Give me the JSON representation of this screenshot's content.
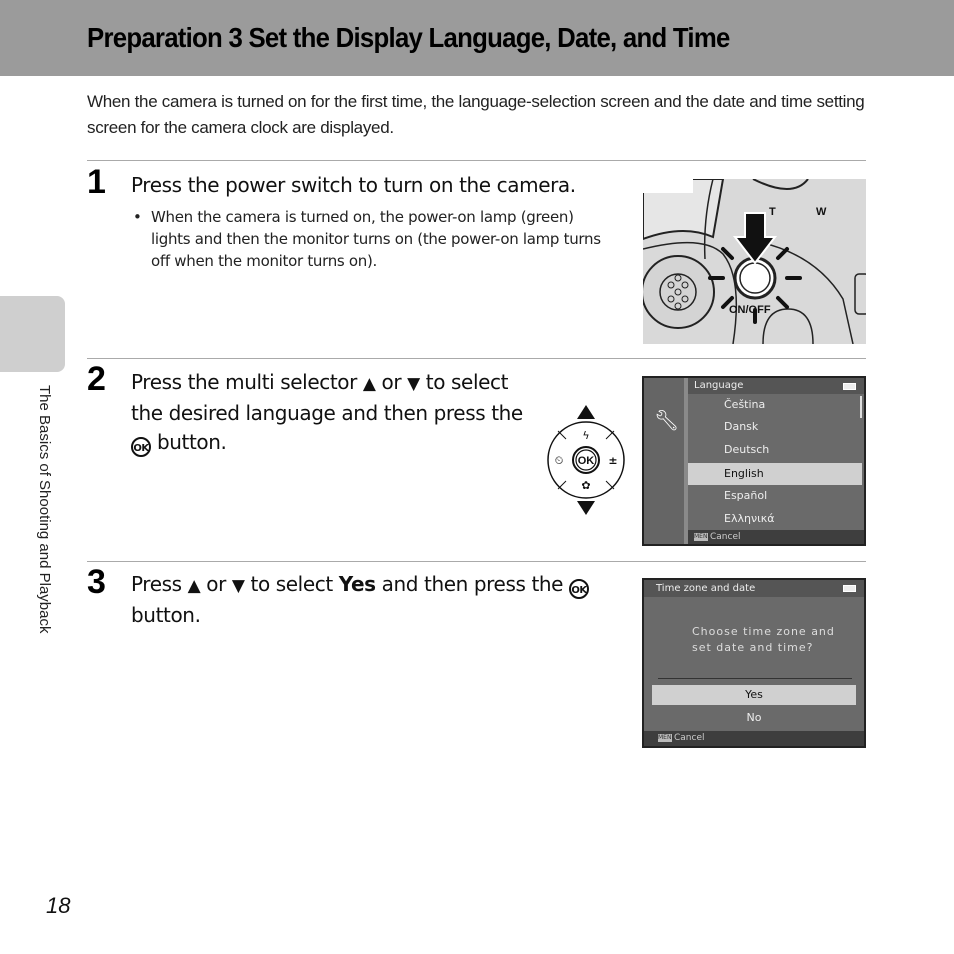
{
  "header": {
    "title": "Preparation 3 Set the Display Language, Date, and Time"
  },
  "intro": "When the camera is turned on for the first time, the language-selection screen and the date and time setting screen for the camera clock are displayed.",
  "side_tab": {
    "label": "The Basics of Shooting and Playback"
  },
  "steps": [
    {
      "number": "1",
      "title": "Press the power switch to turn on the camera.",
      "bullets": [
        "When the camera is turned on, the power-on lamp (green) lights and then the monitor turns on (the power-on lamp turns off when the monitor turns on)."
      ],
      "illustration": {
        "zoom_tele": "T",
        "zoom_wide": "W",
        "power_label": "ON/OFF"
      }
    },
    {
      "number": "2",
      "title_parts": [
        "Press the multi selector ",
        "▲",
        " or ",
        "▼",
        " to select the desired language and then press the ",
        "OK",
        " button."
      ],
      "multi_selector": {
        "center": "OK",
        "up": "▲",
        "down": "▼",
        "top": "ϟ",
        "left": "⏲",
        "right": "±",
        "bottom": "✿"
      },
      "screen": {
        "title": "Language",
        "items": [
          "Čeština",
          "Dansk",
          "Deutsch",
          "English",
          "Español",
          "Ελληνικά"
        ],
        "selected": "English",
        "footer_key": "MENU",
        "footer": "Cancel"
      }
    },
    {
      "number": "3",
      "title_parts": [
        "Press ",
        "▲",
        " or ",
        "▼",
        " to select ",
        "Yes",
        " and then press the ",
        "OK",
        " button."
      ],
      "screen": {
        "title": "Time zone and date",
        "question_line1": "Choose time zone and",
        "question_line2": "set date and time?",
        "options": [
          "Yes",
          "No"
        ],
        "selected": "Yes",
        "footer_key": "MENU",
        "footer": "Cancel"
      }
    }
  ],
  "page_number": "18"
}
